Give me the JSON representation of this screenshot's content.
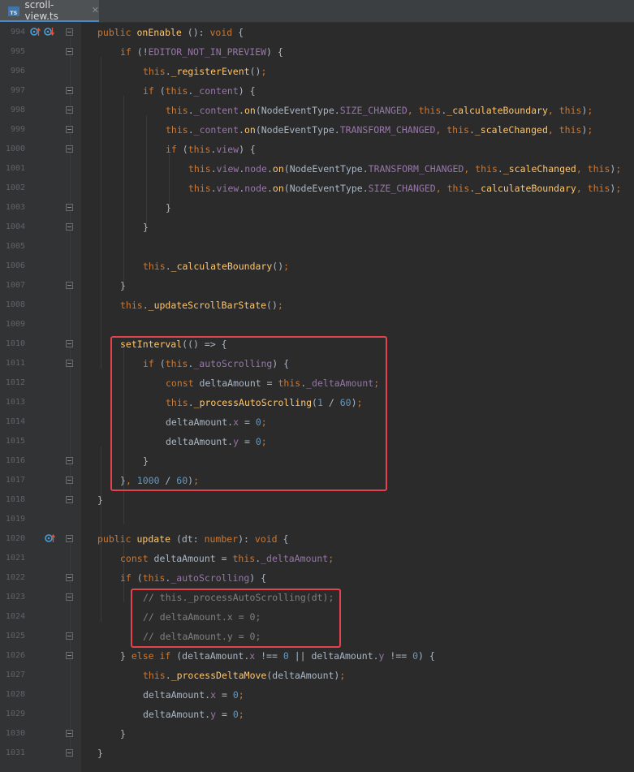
{
  "tab": {
    "label": "scroll-view.ts",
    "badge": "TS",
    "close": "✕"
  },
  "lines": [
    {
      "n": "994",
      "t": [
        [
          "kw",
          "public "
        ],
        [
          "fn",
          "onEnable"
        ],
        [
          "pl",
          " (): "
        ],
        [
          "kw",
          "void"
        ],
        [
          "pl",
          " {"
        ]
      ],
      "indent": 0
    },
    {
      "n": "995",
      "t": [
        [
          "kw",
          "if"
        ],
        [
          "pl",
          " (!"
        ],
        [
          "fld",
          "EDITOR_NOT_IN_PREVIEW"
        ],
        [
          "pl",
          ") {"
        ]
      ],
      "indent": 1
    },
    {
      "n": "996",
      "t": [
        [
          "kw",
          "this"
        ],
        [
          "pl",
          "."
        ],
        [
          "fn",
          "_registerEvent"
        ],
        [
          "pl",
          "()"
        ],
        [
          "kw",
          ";"
        ]
      ],
      "indent": 2
    },
    {
      "n": "997",
      "t": [
        [
          "kw",
          "if"
        ],
        [
          "pl",
          " ("
        ],
        [
          "kw",
          "this"
        ],
        [
          "pl",
          "."
        ],
        [
          "fld",
          "_content"
        ],
        [
          "pl",
          ") {"
        ]
      ],
      "indent": 2
    },
    {
      "n": "998",
      "t": [
        [
          "kw",
          "this"
        ],
        [
          "pl",
          "."
        ],
        [
          "fld",
          "_content"
        ],
        [
          "pl",
          "."
        ],
        [
          "fn",
          "on"
        ],
        [
          "pl",
          "(NodeEventType."
        ],
        [
          "fld",
          "SIZE_CHANGED"
        ],
        [
          "kw",
          ", this"
        ],
        [
          "pl",
          "."
        ],
        [
          "fn",
          "_calculateBoundary"
        ],
        [
          "kw",
          ", this"
        ],
        [
          "pl",
          ")"
        ],
        [
          "kw",
          ";"
        ]
      ],
      "indent": 3
    },
    {
      "n": "999",
      "t": [
        [
          "kw",
          "this"
        ],
        [
          "pl",
          "."
        ],
        [
          "fld",
          "_content"
        ],
        [
          "pl",
          "."
        ],
        [
          "fn",
          "on"
        ],
        [
          "pl",
          "(NodeEventType."
        ],
        [
          "fld",
          "TRANSFORM_CHANGED"
        ],
        [
          "kw",
          ", this"
        ],
        [
          "pl",
          "."
        ],
        [
          "fn",
          "_scaleChanged"
        ],
        [
          "kw",
          ", this"
        ],
        [
          "pl",
          ")"
        ],
        [
          "kw",
          ";"
        ]
      ],
      "indent": 3
    },
    {
      "n": "1000",
      "t": [
        [
          "kw",
          "if"
        ],
        [
          "pl",
          " ("
        ],
        [
          "kw",
          "this"
        ],
        [
          "pl",
          "."
        ],
        [
          "fld",
          "view"
        ],
        [
          "pl",
          ") {"
        ]
      ],
      "indent": 3
    },
    {
      "n": "1001",
      "t": [
        [
          "kw",
          "this"
        ],
        [
          "pl",
          "."
        ],
        [
          "fld",
          "view"
        ],
        [
          "pl",
          "."
        ],
        [
          "fld",
          "node"
        ],
        [
          "pl",
          "."
        ],
        [
          "fn",
          "on"
        ],
        [
          "pl",
          "(NodeEventType."
        ],
        [
          "fld",
          "TRANSFORM_CHANGED"
        ],
        [
          "kw",
          ", this"
        ],
        [
          "pl",
          "."
        ],
        [
          "fn",
          "_scaleChanged"
        ],
        [
          "kw",
          ", this"
        ],
        [
          "pl",
          ")"
        ],
        [
          "kw",
          ";"
        ]
      ],
      "indent": 4
    },
    {
      "n": "1002",
      "t": [
        [
          "kw",
          "this"
        ],
        [
          "pl",
          "."
        ],
        [
          "fld",
          "view"
        ],
        [
          "pl",
          "."
        ],
        [
          "fld",
          "node"
        ],
        [
          "pl",
          "."
        ],
        [
          "fn",
          "on"
        ],
        [
          "pl",
          "(NodeEventType."
        ],
        [
          "fld",
          "SIZE_CHANGED"
        ],
        [
          "kw",
          ", this"
        ],
        [
          "pl",
          "."
        ],
        [
          "fn",
          "_calculateBoundary"
        ],
        [
          "kw",
          ", this"
        ],
        [
          "pl",
          ")"
        ],
        [
          "kw",
          ";"
        ]
      ],
      "indent": 4
    },
    {
      "n": "1003",
      "t": [
        [
          "pl",
          "}"
        ]
      ],
      "indent": 3
    },
    {
      "n": "1004",
      "t": [
        [
          "pl",
          "}"
        ]
      ],
      "indent": 2
    },
    {
      "n": "1005",
      "t": [],
      "indent": 0
    },
    {
      "n": "1006",
      "t": [
        [
          "kw",
          "this"
        ],
        [
          "pl",
          "."
        ],
        [
          "fn",
          "_calculateBoundary"
        ],
        [
          "pl",
          "()"
        ],
        [
          "kw",
          ";"
        ]
      ],
      "indent": 2
    },
    {
      "n": "1007",
      "t": [
        [
          "pl",
          "}"
        ]
      ],
      "indent": 1
    },
    {
      "n": "1008",
      "t": [
        [
          "kw",
          "this"
        ],
        [
          "pl",
          "."
        ],
        [
          "fn",
          "_updateScrollBarState"
        ],
        [
          "pl",
          "()"
        ],
        [
          "kw",
          ";"
        ]
      ],
      "indent": 1
    },
    {
      "n": "1009",
      "t": [],
      "indent": 0
    },
    {
      "n": "1010",
      "t": [
        [
          "fn",
          "setInterval"
        ],
        [
          "pl",
          "(() => {"
        ]
      ],
      "indent": 1
    },
    {
      "n": "1011",
      "t": [
        [
          "kw",
          "if"
        ],
        [
          "pl",
          " ("
        ],
        [
          "kw",
          "this"
        ],
        [
          "pl",
          "."
        ],
        [
          "fld",
          "_autoScrolling"
        ],
        [
          "pl",
          ") {"
        ]
      ],
      "indent": 2
    },
    {
      "n": "1012",
      "t": [
        [
          "kw",
          "const "
        ],
        [
          "pl",
          "deltaAmount = "
        ],
        [
          "kw",
          "this"
        ],
        [
          "pl",
          "."
        ],
        [
          "fld",
          "_deltaAmount"
        ],
        [
          "kw",
          ";"
        ]
      ],
      "indent": 3
    },
    {
      "n": "1013",
      "t": [
        [
          "kw",
          "this"
        ],
        [
          "pl",
          "."
        ],
        [
          "fn",
          "_processAutoScrolling"
        ],
        [
          "pl",
          "("
        ],
        [
          "num",
          "1"
        ],
        [
          "pl",
          " / "
        ],
        [
          "num",
          "60"
        ],
        [
          "pl",
          ")"
        ],
        [
          "kw",
          ";"
        ]
      ],
      "indent": 3
    },
    {
      "n": "1014",
      "t": [
        [
          "pl",
          "deltaAmount."
        ],
        [
          "fld",
          "x"
        ],
        [
          "pl",
          " = "
        ],
        [
          "num",
          "0"
        ],
        [
          "kw",
          ";"
        ]
      ],
      "indent": 3
    },
    {
      "n": "1015",
      "t": [
        [
          "pl",
          "deltaAmount."
        ],
        [
          "fld",
          "y"
        ],
        [
          "pl",
          " = "
        ],
        [
          "num",
          "0"
        ],
        [
          "kw",
          ";"
        ]
      ],
      "indent": 3
    },
    {
      "n": "1016",
      "t": [
        [
          "pl",
          "}"
        ]
      ],
      "indent": 2
    },
    {
      "n": "1017",
      "t": [
        [
          "pl",
          "}"
        ],
        [
          "kw",
          ", "
        ],
        [
          "num",
          "1000"
        ],
        [
          "pl",
          " / "
        ],
        [
          "num",
          "60"
        ],
        [
          "pl",
          ")"
        ],
        [
          "kw",
          ";"
        ]
      ],
      "indent": 1
    },
    {
      "n": "1018",
      "t": [
        [
          "pl",
          "}"
        ]
      ],
      "indent": 0
    },
    {
      "n": "1019",
      "t": [],
      "indent": 0
    },
    {
      "n": "1020",
      "t": [
        [
          "kw",
          "public "
        ],
        [
          "fn",
          "update"
        ],
        [
          "pl",
          " (dt: "
        ],
        [
          "kw",
          "number"
        ],
        [
          "pl",
          "): "
        ],
        [
          "kw",
          "void"
        ],
        [
          "pl",
          " {"
        ]
      ],
      "indent": 0
    },
    {
      "n": "1021",
      "t": [
        [
          "kw",
          "const "
        ],
        [
          "pl",
          "deltaAmount = "
        ],
        [
          "kw",
          "this"
        ],
        [
          "pl",
          "."
        ],
        [
          "fld",
          "_deltaAmount"
        ],
        [
          "kw",
          ";"
        ]
      ],
      "indent": 1
    },
    {
      "n": "1022",
      "t": [
        [
          "kw",
          "if"
        ],
        [
          "pl",
          " ("
        ],
        [
          "kw",
          "this"
        ],
        [
          "pl",
          "."
        ],
        [
          "fld",
          "_autoScrolling"
        ],
        [
          "pl",
          ") {"
        ]
      ],
      "indent": 1
    },
    {
      "n": "1023",
      "t": [
        [
          "cm",
          "// this._processAutoScrolling(dt);"
        ]
      ],
      "indent": 2
    },
    {
      "n": "1024",
      "t": [
        [
          "cm",
          "// deltaAmount.x = 0;"
        ]
      ],
      "indent": 2
    },
    {
      "n": "1025",
      "t": [
        [
          "cm",
          "// deltaAmount.y = 0;"
        ]
      ],
      "indent": 2
    },
    {
      "n": "1026",
      "t": [
        [
          "pl",
          "} "
        ],
        [
          "kw",
          "else if"
        ],
        [
          "pl",
          " (deltaAmount."
        ],
        [
          "fld",
          "x"
        ],
        [
          "pl",
          " !== "
        ],
        [
          "num",
          "0"
        ],
        [
          "pl",
          " || deltaAmount."
        ],
        [
          "fld",
          "y"
        ],
        [
          "pl",
          " !== "
        ],
        [
          "num",
          "0"
        ],
        [
          "pl",
          ") {"
        ]
      ],
      "indent": 1
    },
    {
      "n": "1027",
      "t": [
        [
          "kw",
          "this"
        ],
        [
          "pl",
          "."
        ],
        [
          "fn",
          "_processDeltaMove"
        ],
        [
          "pl",
          "(deltaAmount)"
        ],
        [
          "kw",
          ";"
        ]
      ],
      "indent": 2
    },
    {
      "n": "1028",
      "t": [
        [
          "pl",
          "deltaAmount."
        ],
        [
          "fld",
          "x"
        ],
        [
          "pl",
          " = "
        ],
        [
          "num",
          "0"
        ],
        [
          "kw",
          ";"
        ]
      ],
      "indent": 2
    },
    {
      "n": "1029",
      "t": [
        [
          "pl",
          "deltaAmount."
        ],
        [
          "fld",
          "y"
        ],
        [
          "pl",
          " = "
        ],
        [
          "num",
          "0"
        ],
        [
          "kw",
          ";"
        ]
      ],
      "indent": 2
    },
    {
      "n": "1030",
      "t": [
        [
          "pl",
          "}"
        ]
      ],
      "indent": 1
    },
    {
      "n": "1031",
      "t": [
        [
          "pl",
          "}"
        ]
      ],
      "indent": 0
    }
  ],
  "fold_marks": [
    "994",
    "995",
    "997",
    "998",
    "999",
    "1000",
    "1003",
    "1004",
    "1007",
    "1010",
    "1011",
    "1016",
    "1017",
    "1018",
    "1020",
    "1022",
    "1023",
    "1025",
    "1026",
    "1030",
    "1031"
  ],
  "gutter_icons": {
    "994": [
      "override-up-icon",
      "override-down-icon"
    ],
    "1020": [
      "override-up-icon"
    ]
  },
  "colors": {
    "highlight_box": "#e2434f",
    "accent": "#4a88c7"
  }
}
